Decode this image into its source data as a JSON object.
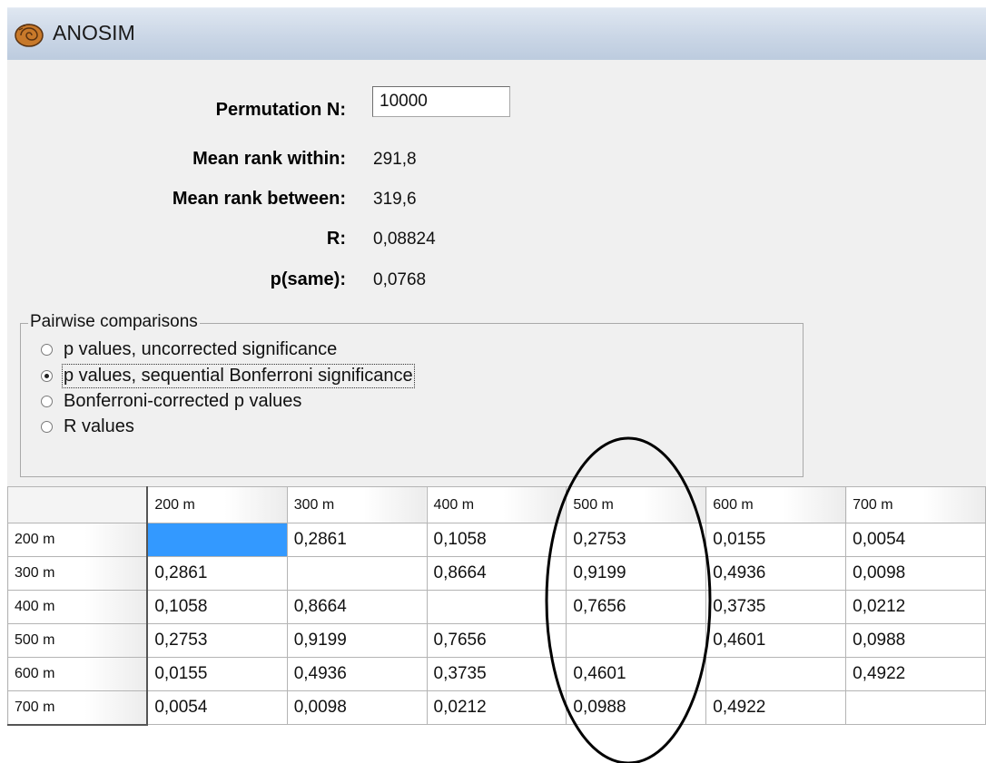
{
  "window": {
    "title": "ANOSIM",
    "icon": "ammonite-shell-icon"
  },
  "parameters": {
    "permutation_label": "Permutation N:",
    "permutation_value": "10000",
    "mean_within_label": "Mean rank within:",
    "mean_within_value": "291,8",
    "mean_between_label": "Mean rank between:",
    "mean_between_value": "319,6",
    "r_label": "R:",
    "r_value": "0,08824",
    "p_label": "p(same):",
    "p_value": "0,0768"
  },
  "pairwise": {
    "legend": "Pairwise comparisons",
    "options": [
      {
        "label": "p values, uncorrected significance",
        "selected": false
      },
      {
        "label": "p values, sequential Bonferroni significance",
        "selected": true
      },
      {
        "label": "Bonferroni-corrected p values",
        "selected": false
      },
      {
        "label": "R values",
        "selected": false
      }
    ]
  },
  "table": {
    "columns": [
      "200 m",
      "300 m",
      "400 m",
      "500 m",
      "600 m",
      "700 m"
    ],
    "rows": [
      {
        "label": "200 m",
        "cells": [
          "",
          "0,2861",
          "0,1058",
          "0,2753",
          "0,0155",
          "0,0054"
        ]
      },
      {
        "label": "300 m",
        "cells": [
          "0,2861",
          "",
          "0,8664",
          "0,9199",
          "0,4936",
          "0,0098"
        ]
      },
      {
        "label": "400 m",
        "cells": [
          "0,1058",
          "0,8664",
          "",
          "0,7656",
          "0,3735",
          "0,0212"
        ]
      },
      {
        "label": "500 m",
        "cells": [
          "0,2753",
          "0,9199",
          "0,7656",
          "",
          "0,4601",
          "0,0988"
        ]
      },
      {
        "label": "600 m",
        "cells": [
          "0,0155",
          "0,4936",
          "0,3735",
          "0,4601",
          "",
          "0,4922"
        ]
      },
      {
        "label": "700 m",
        "cells": [
          "0,0054",
          "0,0098",
          "0,0212",
          "0,0988",
          "0,4922",
          ""
        ]
      }
    ],
    "selected_cell": {
      "row": 0,
      "col": 0
    },
    "selected_color": "#3399ff",
    "highlighted_column": "500 m"
  }
}
